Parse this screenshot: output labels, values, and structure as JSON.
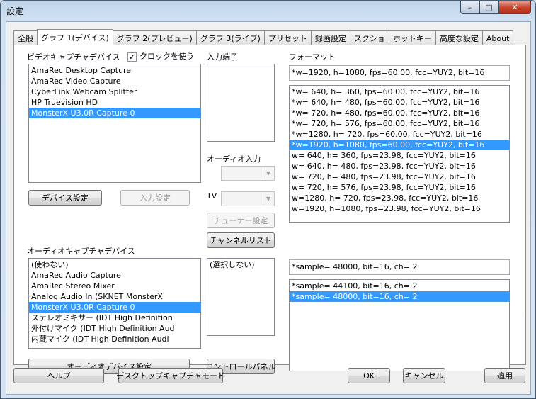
{
  "window": {
    "title": "設定",
    "minimize": "–",
    "maximize": "□",
    "close": "✕"
  },
  "tabs": [
    "全般",
    "グラフ 1(デバイス)",
    "グラフ 2(プレビュー)",
    "グラフ 3(ライブ)",
    "プリセット",
    "録画設定",
    "スクショ",
    "ホットキー",
    "高度な設定",
    "About"
  ],
  "active_tab": 1,
  "video": {
    "label": "ビデオキャプチャデバイス",
    "clock_label": "クロックを使う",
    "clock_checked": true,
    "devices": [
      "AmaRec Desktop Capture",
      "AmaRec Video Capture",
      "CyberLink Webcam Splitter",
      "HP Truevision HD",
      "MonsterX U3.0R Capture 0"
    ],
    "selected": 4,
    "device_settings_button": "デバイス設定",
    "input_settings_button": "入力設定"
  },
  "input_terminal": {
    "label": "入力端子",
    "items": [],
    "audio_input_label": "オーディオ入力",
    "tv_label": "TV",
    "tuner_button": "チューナー設定",
    "channel_list_button": "チャンネルリスト"
  },
  "format": {
    "label": "フォーマット",
    "current": "*w=1920, h=1080, fps=60.00,  fcc=YUY2, bit=16",
    "items": [
      "*w= 640, h= 360, fps=60.00,  fcc=YUY2, bit=16",
      "*w= 640, h= 480, fps=60.00,  fcc=YUY2, bit=16",
      "*w= 720, h= 480, fps=60.00,  fcc=YUY2, bit=16",
      "*w= 720, h= 576, fps=60.00,  fcc=YUY2, bit=16",
      "*w=1280, h= 720, fps=60.00,  fcc=YUY2, bit=16",
      "*w=1920, h=1080, fps=60.00,  fcc=YUY2, bit=16",
      "w= 640, h= 360, fps=23.98,  fcc=YUY2, bit=16",
      "w= 640, h= 480, fps=23.98,  fcc=YUY2, bit=16",
      "w= 720, h= 480, fps=23.98,  fcc=YUY2, bit=16",
      "w= 720, h= 576, fps=23.98,  fcc=YUY2, bit=16",
      "w=1280, h= 720, fps=23.98,  fcc=YUY2, bit=16",
      "w=1920, h=1080, fps=23.98,  fcc=YUY2, bit=16"
    ],
    "selected": 5
  },
  "audio": {
    "label": "オーディオキャプチャデバイス",
    "devices": [
      "(使わない)",
      "AmaRec Audio Capture",
      "AmaRec Stereo Mixer",
      "Analog Audio In (SKNET MonsterX",
      "MonsterX U3.0R Capture 0",
      "ステレオミキサー (IDT High Definition",
      "外付けマイク (IDT High Definition Aud",
      "内蔵マイク (IDT High Definition Audi"
    ],
    "selected": 4,
    "pins": [
      "(選択しない)"
    ],
    "device_settings_button": "オーディオデバイス設定",
    "control_panel_button": "コントロールパネル",
    "current_format": "*sample= 48000, bit=16, ch= 2",
    "formats": [
      "*sample= 44100, bit=16, ch= 2",
      "*sample= 48000, bit=16, ch= 2"
    ],
    "format_selected": 1
  },
  "footer": {
    "help": "ヘルプ",
    "desktop_capture_mode": "デスクトップキャプチャモード",
    "ok": "OK",
    "cancel": "キャンセル",
    "apply": "適用"
  }
}
